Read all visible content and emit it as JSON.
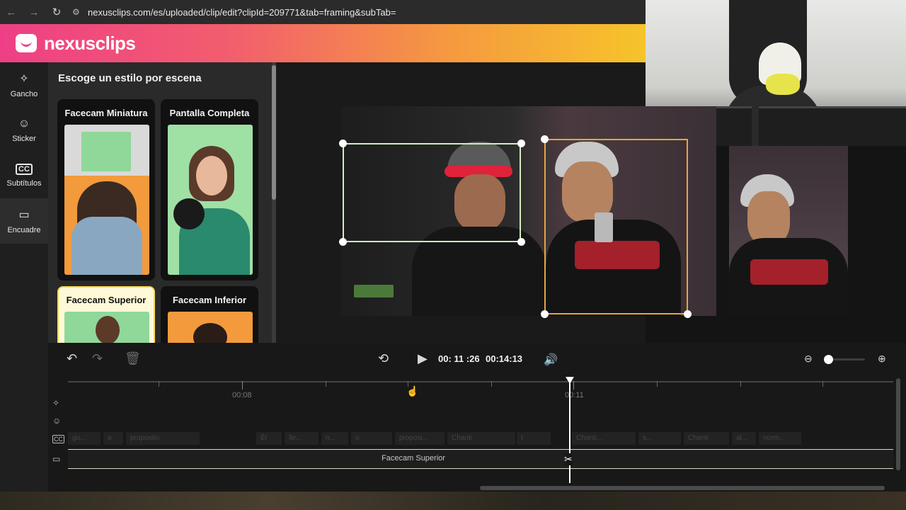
{
  "browser": {
    "url": "nexusclips.com/es/uploaded/clip/edit?clipId=209771&tab=framing&subTab="
  },
  "brand": {
    "name": "nexusclips",
    "accent": "#ee3f86"
  },
  "rail": {
    "items": [
      {
        "label": "Gancho",
        "icon": "sparkle-cursor-icon"
      },
      {
        "label": "Sticker",
        "icon": "sticker-icon"
      },
      {
        "label": "Subtítulos",
        "icon": "cc-icon"
      },
      {
        "label": "Encuadre",
        "icon": "video-camera-icon"
      }
    ]
  },
  "panel": {
    "title": "Escoge un estilo por escena",
    "cards": [
      {
        "label": "Facecam Miniatura"
      },
      {
        "label": "Pantalla Completa"
      },
      {
        "label": "Facecam Superior",
        "selected": true
      },
      {
        "label": "Facecam Inferior"
      }
    ]
  },
  "player": {
    "current_time": "00: 11 :26",
    "total_time": "00:14:13",
    "zoom_level": 0.05
  },
  "timeline": {
    "tick_labels": [
      "00:08",
      "00:11"
    ],
    "subtitle_chips": [
      "gu...",
      "a",
      "proposito",
      "Él",
      "lle...",
      "n...",
      "o",
      "proposi...",
      "Chanti",
      "t",
      "Chanti...",
      "s...",
      "Chanti",
      "al...",
      "norm..."
    ],
    "video_clip_label": "Facecam Superior"
  }
}
